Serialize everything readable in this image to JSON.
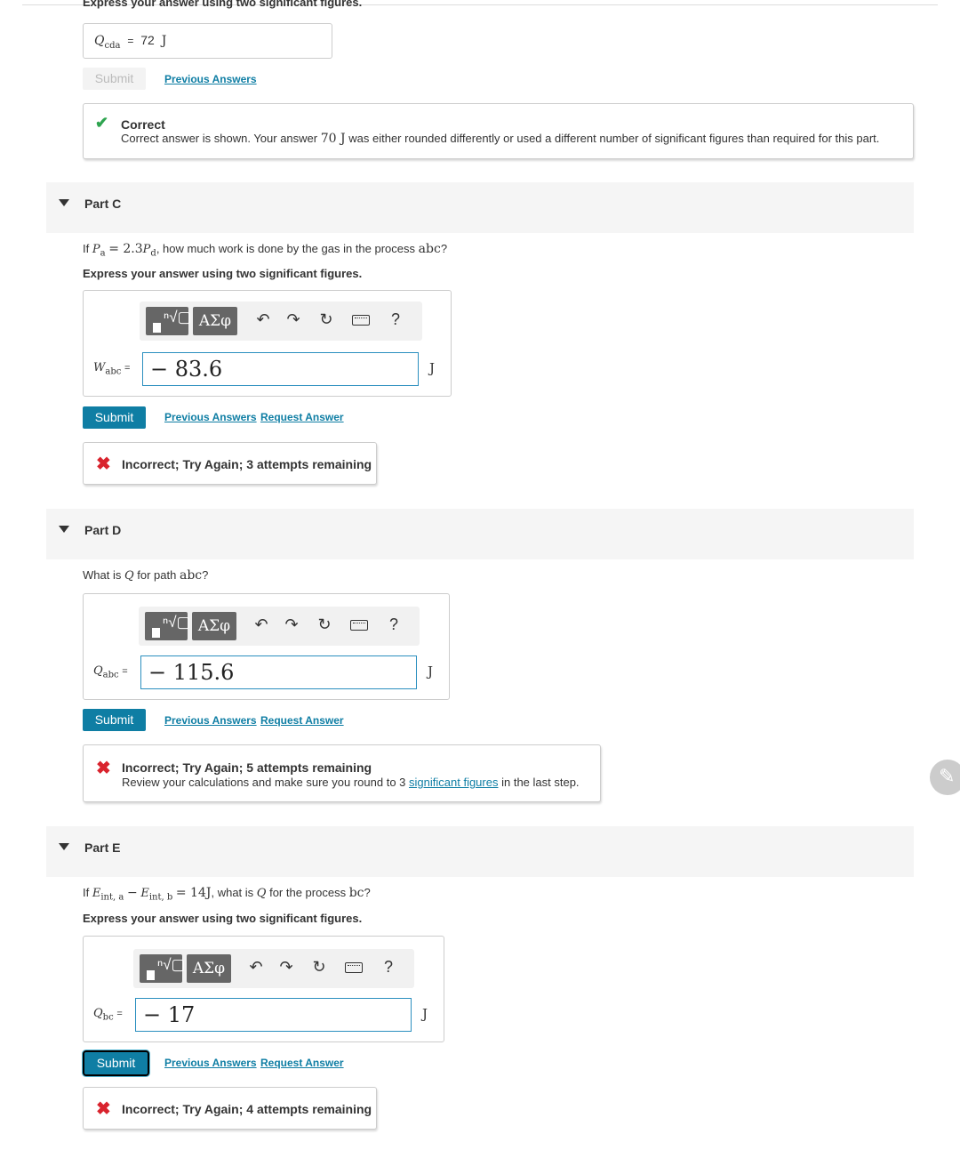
{
  "top": {
    "instruction_cut": "Express your answer using two significant figures.",
    "answer_var": "Q",
    "answer_sub": "cda",
    "answer_equals": "=",
    "answer_value": "72",
    "answer_unit": "J",
    "submit_label": "Submit",
    "previous_answers": "Previous Answers",
    "feedback_title": "Correct",
    "feedback_text_before": "Correct answer is shown. Your answer",
    "feedback_text_value": "70 J",
    "feedback_text_after": "was either rounded differently or used a different number of significant figures than required for this part."
  },
  "toolbar": {
    "greek": "ΑΣφ",
    "undo": "↶",
    "redo": "↷",
    "reset": "↻",
    "help": "?"
  },
  "partC": {
    "label": "Part C",
    "q_if": "If",
    "q_pa": "P",
    "q_pa_sub": "a",
    "q_eq": "= 2.3",
    "q_pd": "P",
    "q_pd_sub": "d",
    "q_rest": ", how much work is done by the gas in the process",
    "q_proc": "abc",
    "q_end": "?",
    "instruction": "Express your answer using two significant figures.",
    "var": "W",
    "var_sub": "abc",
    "equals": "=",
    "value": "− 83.6",
    "unit": "J",
    "submit_label": "Submit",
    "previous_answers": "Previous Answers",
    "request_answer": "Request Answer",
    "feedback_title": "Incorrect; Try Again; 3 attempts remaining"
  },
  "partD": {
    "label": "Part D",
    "q_what": "What is",
    "q_var": "Q",
    "q_rest": "for path",
    "q_proc": "abc",
    "q_end": "?",
    "var": "Q",
    "var_sub": "abc",
    "equals": "=",
    "value": "− 115.6",
    "unit": "J",
    "submit_label": "Submit",
    "previous_answers": "Previous Answers",
    "request_answer": "Request Answer",
    "feedback_title": "Incorrect; Try Again; 5 attempts remaining",
    "feedback_text_before": "Review your calculations and make sure you round to 3",
    "feedback_link": "significant figures",
    "feedback_text_after": "in the last step."
  },
  "partE": {
    "label": "Part E",
    "q_if": "If",
    "q_e1": "E",
    "q_e1_sub": "int, a",
    "q_minus": "−",
    "q_e2": "E",
    "q_e2_sub": "int, b",
    "q_eq": "= 14J",
    "q_rest": ", what is",
    "q_var": "Q",
    "q_rest2": "for the process",
    "q_proc": "bc",
    "q_end": "?",
    "instruction": "Express your answer using two significant figures.",
    "var": "Q",
    "var_sub": "bc",
    "equals": "=",
    "value": "− 17",
    "unit": "J",
    "submit_label": "Submit",
    "previous_answers": "Previous Answers",
    "request_answer": "Request Answer",
    "feedback_title": "Incorrect; Try Again; 4 attempts remaining"
  },
  "colors": {
    "primary_button": "#0f7ea4",
    "link": "#0f7ea4",
    "correct": "#2ea44f",
    "incorrect": "#d9232d",
    "field_border": "#2b8fbf"
  },
  "icons": [
    "check-icon",
    "x-icon",
    "template-icon",
    "greek-icon",
    "undo-icon",
    "redo-icon",
    "reset-icon",
    "keyboard-icon",
    "help-icon",
    "pencil-icon",
    "collapse-triangle-icon"
  ]
}
